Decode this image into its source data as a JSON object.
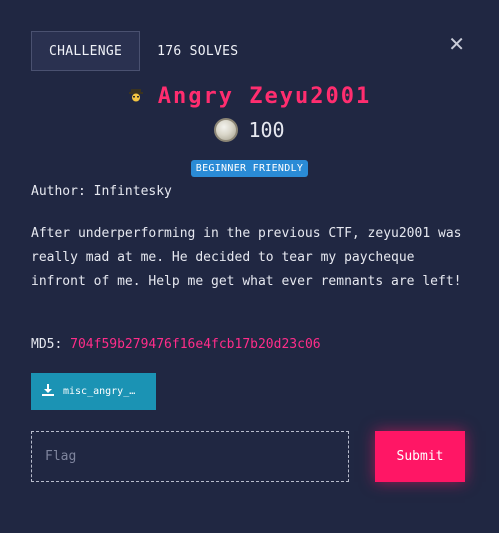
{
  "tabs": {
    "challenge_label": "CHALLENGE",
    "solves_label": "176 SOLVES"
  },
  "close_icon": "close-icon",
  "challenge": {
    "icon": "detective-emoji-icon",
    "title": "Angry Zeyu2001",
    "points": "100",
    "badge": "BEGINNER FRIENDLY",
    "author": "Author: Infintesky",
    "description": "After underperforming in the previous CTF, zeyu2001 was really mad at me. He decided to tear my paycheque infront of me. Help me get what ever remnants are left!",
    "md5_label": "MD5: ",
    "md5_hash": "704f59b279476f16e4fcb17b20d23c06",
    "download_file": "misc_angry_…"
  },
  "flag_input": {
    "placeholder": "Flag",
    "value": ""
  },
  "submit_label": "Submit",
  "colors": {
    "background": "#202742",
    "title": "#ff2d6f",
    "hash": "#ff2d8a",
    "badge": "#2a8bd6",
    "download": "#1b93b4",
    "submit": "#ff1665"
  }
}
